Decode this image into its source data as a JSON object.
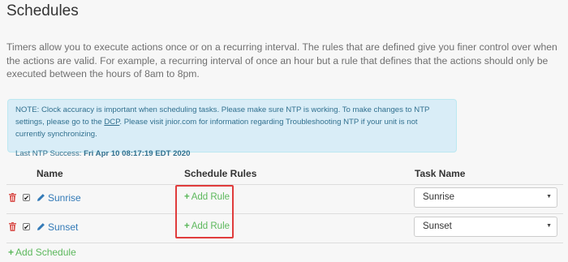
{
  "page": {
    "title": "Schedules",
    "intro": "Timers allow you to execute actions once or on a recurring interval. The rules that are defined give you finer control over when the actions are valid. For example, a recurring interval of once an hour but a rule that defines that the actions should only be executed between the hours of 8am to 8pm."
  },
  "note": {
    "text_before_link": "NOTE: Clock accuracy is important when scheduling tasks. Please make sure NTP is working. To make changes to NTP settings, please go to the ",
    "link_text": "DCP",
    "text_after_link": ". Please visit jnior.com for information regarding Troubleshooting NTP if your unit is not currently synchronizing.",
    "last_sync_label": "Last NTP Success: ",
    "last_sync_value": "Fri Apr 10 08:17:19 EDT 2020"
  },
  "table": {
    "headers": {
      "name": "Name",
      "rules": "Schedule Rules",
      "task": "Task Name"
    },
    "rows": [
      {
        "name": "Sunrise",
        "checked": "✔",
        "add_rule": "Add Rule",
        "task": "Sunrise"
      },
      {
        "name": "Sunset",
        "checked": "✔",
        "add_rule": "Add Rule",
        "task": "Sunset"
      }
    ]
  },
  "actions": {
    "add_schedule": "Add Schedule",
    "plus": "+"
  },
  "icons": {
    "trash": "trash-icon",
    "pencil": "pencil-icon",
    "caret": "▼"
  },
  "colors": {
    "link": "#337ab7",
    "success": "#5cb85c",
    "danger": "#d9534f",
    "info_bg": "#d9edf7",
    "highlight": "#e03c3c"
  }
}
